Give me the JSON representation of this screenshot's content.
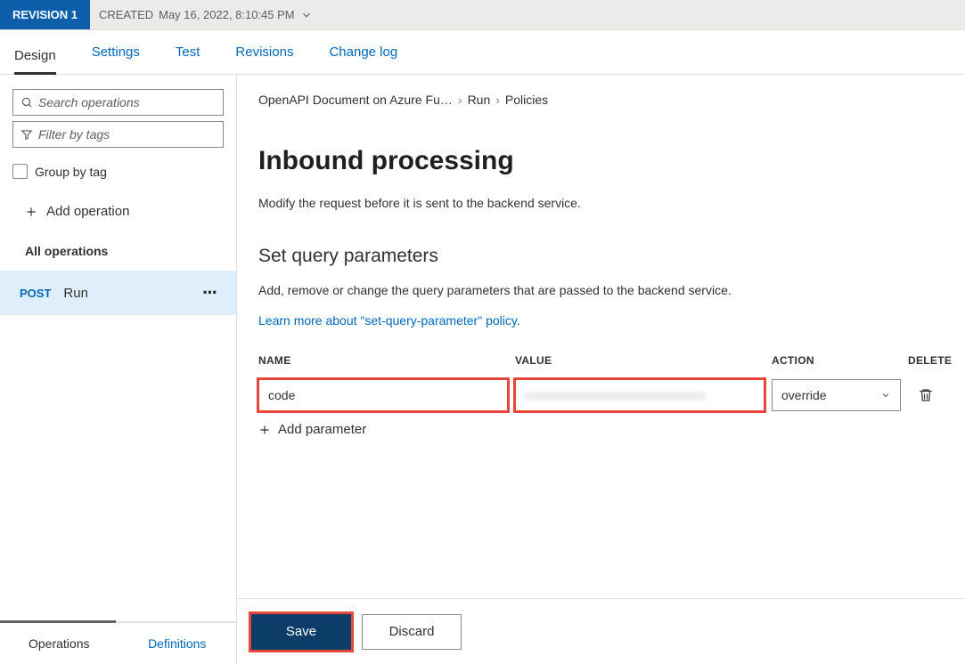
{
  "revBar": {
    "badge": "REVISION 1",
    "created_prefix": "CREATED",
    "created": "May 16, 2022, 8:10:45 PM"
  },
  "tabs": {
    "design": "Design",
    "settings": "Settings",
    "test": "Test",
    "revisions": "Revisions",
    "change_log": "Change log"
  },
  "sidebar": {
    "search_placeholder": "Search operations",
    "filter_placeholder": "Filter by tags",
    "group_label": "Group by tag",
    "add_op": "Add operation",
    "all_ops": "All operations",
    "op_method": "POST",
    "op_name": "Run",
    "bottom_ops": "Operations",
    "bottom_defs": "Definitions"
  },
  "breadcrumb": {
    "a": "OpenAPI Document on Azure Fu…",
    "b": "Run",
    "c": "Policies"
  },
  "main": {
    "h1": "Inbound processing",
    "sub": "Modify the request before it is sent to the backend service.",
    "h2": "Set query parameters",
    "desc": "Add, remove or change the query parameters that are passed to the backend service.",
    "learn": "Learn more about \"set-query-parameter\" policy."
  },
  "table": {
    "col_name": "NAME",
    "col_value": "VALUE",
    "col_action": "ACTION",
    "col_delete": "DELETE",
    "row0_name": "code",
    "row0_value": "",
    "row0_action": "override",
    "add_param": "Add parameter"
  },
  "footer": {
    "save": "Save",
    "discard": "Discard"
  }
}
